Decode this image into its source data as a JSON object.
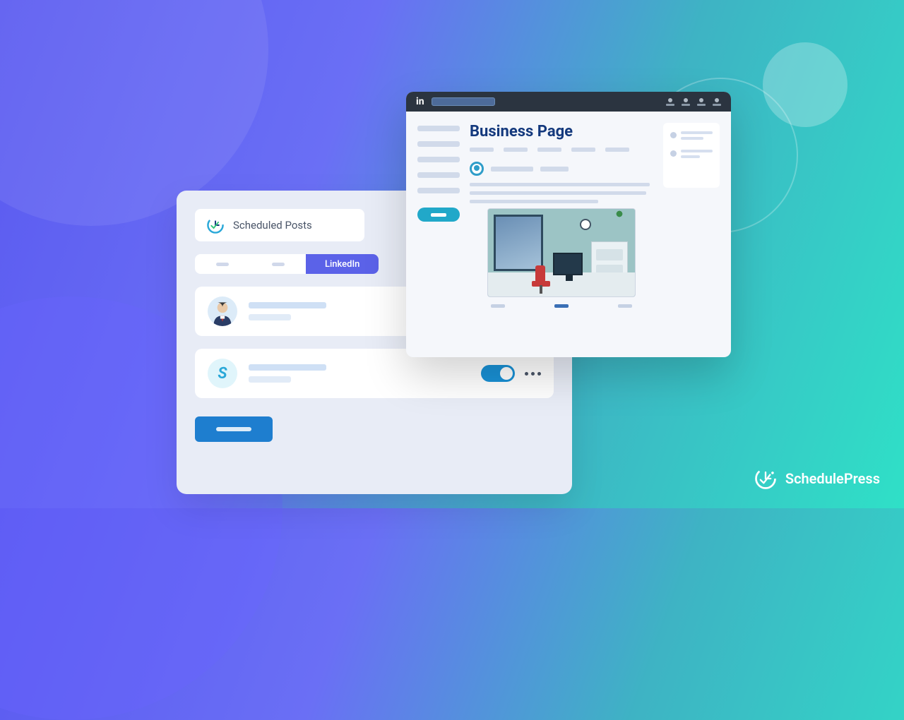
{
  "brand": {
    "name": "SchedulePress"
  },
  "schedulePanel": {
    "title": "Scheduled Posts",
    "tabs": {
      "active_label": "LinkedIn"
    }
  },
  "linkedinPanel": {
    "topbar": {
      "logo_text": "in"
    },
    "page_title": "Business Page"
  }
}
